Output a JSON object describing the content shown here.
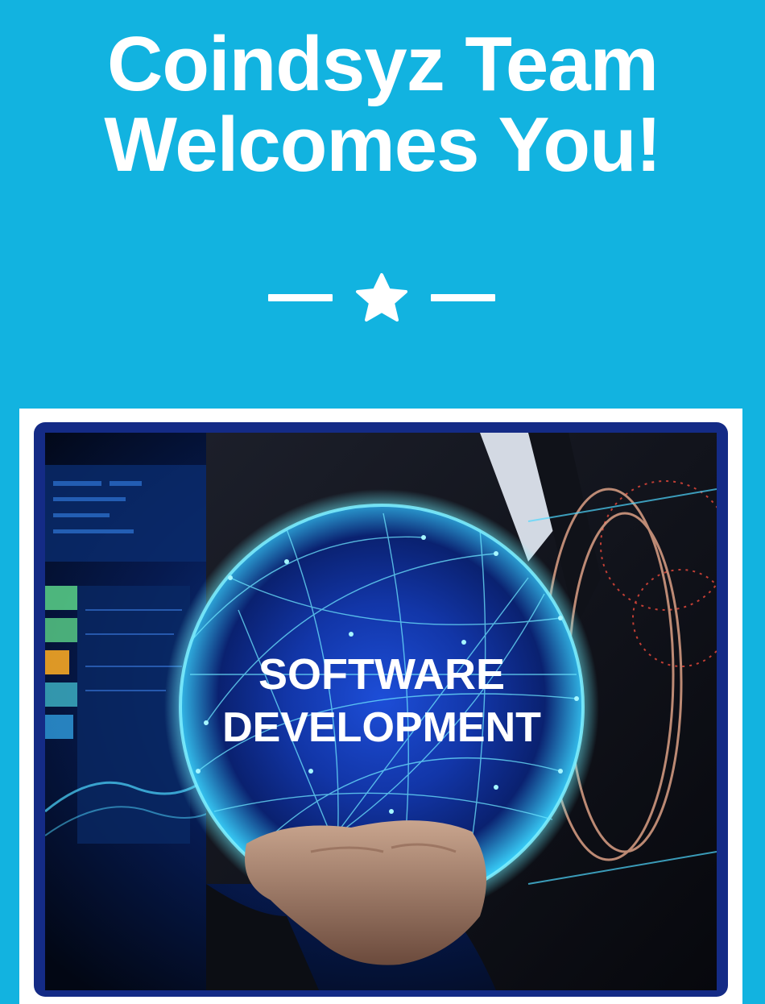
{
  "header": {
    "title_line1": "Coindsyz Team",
    "title_line2": "Welcomes You!"
  },
  "divider": {
    "icon": "star-icon"
  },
  "hero_image": {
    "text_line1": "SOFTWARE",
    "text_line2": "DEVELOPMENT"
  },
  "colors": {
    "background": "#12b3e0",
    "text": "#ffffff",
    "frame": "#142b86"
  }
}
